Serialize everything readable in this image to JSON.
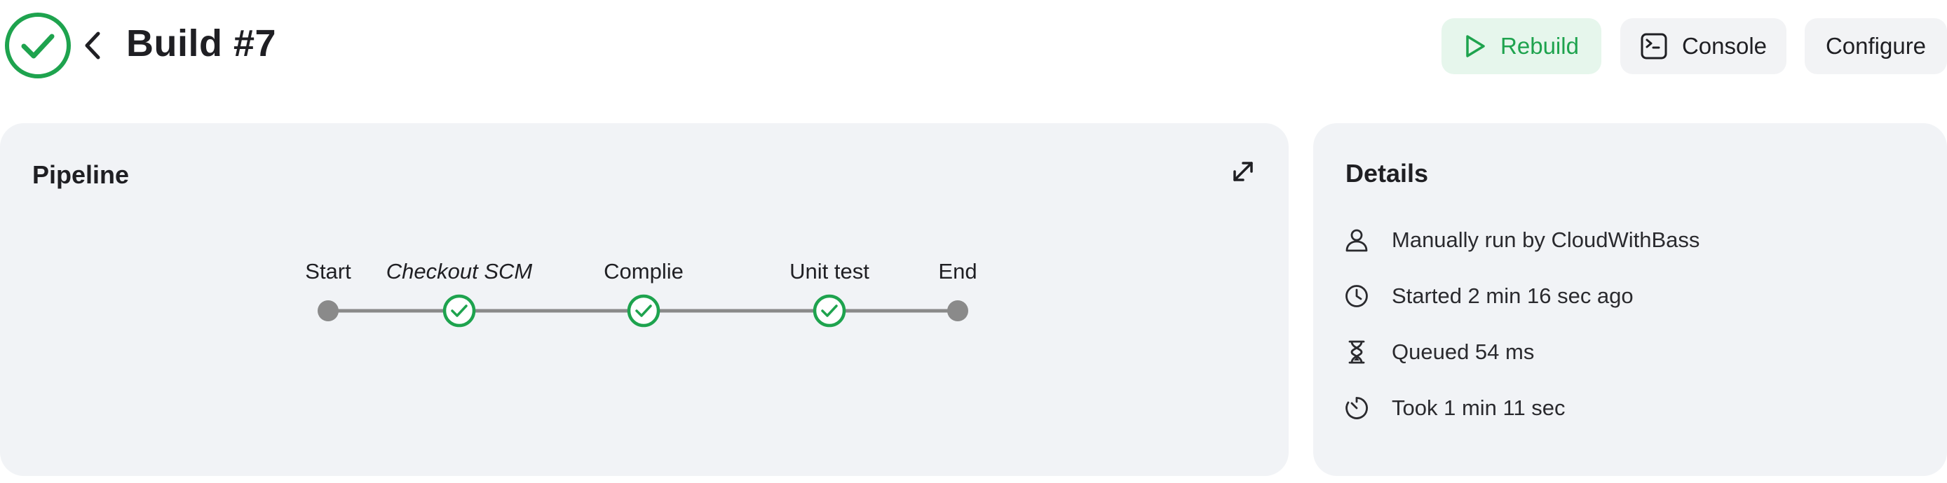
{
  "header": {
    "title": "Build #7",
    "status": "success",
    "status_color": "#1ea34e"
  },
  "toolbar": {
    "rebuild_label": "Rebuild",
    "console_label": "Console",
    "configure_label": "Configure"
  },
  "pipeline": {
    "title": "Pipeline",
    "stages": [
      {
        "label": "Start",
        "kind": "start"
      },
      {
        "label": "Checkout SCM",
        "kind": "stage",
        "status": "success"
      },
      {
        "label": "Complie",
        "kind": "stage",
        "status": "success"
      },
      {
        "label": "Unit test",
        "kind": "stage",
        "status": "success"
      },
      {
        "label": "End",
        "kind": "end"
      }
    ]
  },
  "details": {
    "title": "Details",
    "items": [
      {
        "icon": "user-icon",
        "text": "Manually run by CloudWithBass"
      },
      {
        "icon": "clock-icon",
        "text": "Started 2 min 16 sec ago"
      },
      {
        "icon": "hourglass-icon",
        "text": "Queued 54 ms"
      },
      {
        "icon": "timer-icon",
        "text": "Took 1 min 11 sec"
      }
    ]
  },
  "colors": {
    "success": "#1ea34e",
    "card_bg": "#f1f3f6",
    "line_gray": "#8a8a8a"
  }
}
